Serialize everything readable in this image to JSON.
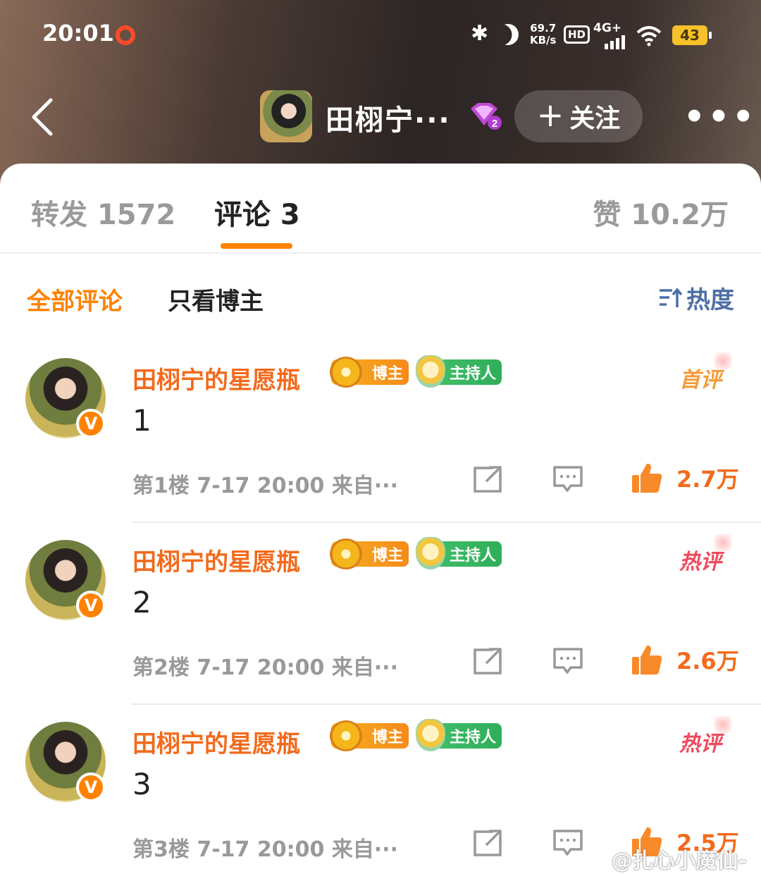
{
  "status_bar": {
    "time": "20:01",
    "speed_value": "69.7",
    "speed_unit": "KB/s",
    "hd": "HD",
    "network": "4G+",
    "battery": "43"
  },
  "header": {
    "back_icon": "chevron-left-icon",
    "name": "田栩宁···",
    "follow_label": "关注",
    "more_label": "•••"
  },
  "tabs": {
    "repost": "转发 1572",
    "comment": "评论 3",
    "like": "赞 10.2万"
  },
  "filters": {
    "all": "全部评论",
    "host_only": "只看博主",
    "sort": "热度"
  },
  "badges": {
    "host": "博主",
    "anchor": "主持人",
    "vip_level": "2"
  },
  "comments": [
    {
      "author": "田栩宁的星愿瓶",
      "tag": "首评",
      "text": "1",
      "meta": "第1楼 7-17 20:00 来自···",
      "likes": "2.7万"
    },
    {
      "author": "田栩宁的星愿瓶",
      "tag": "热评",
      "text": "2",
      "meta": "第2楼 7-17 20:00 来自···",
      "likes": "2.6万"
    },
    {
      "author": "田栩宁的星愿瓶",
      "tag": "热评",
      "text": "3",
      "meta": "第3楼 7-17 20:00 来自···",
      "likes": "2.5万"
    }
  ],
  "watermark": "@扎心小魔仙-",
  "colors": {
    "accent_orange": "#ff8200",
    "name_orange": "#f36a1c",
    "hot_red": "#ef4a5e",
    "sort_blue": "#4d6fa5"
  }
}
